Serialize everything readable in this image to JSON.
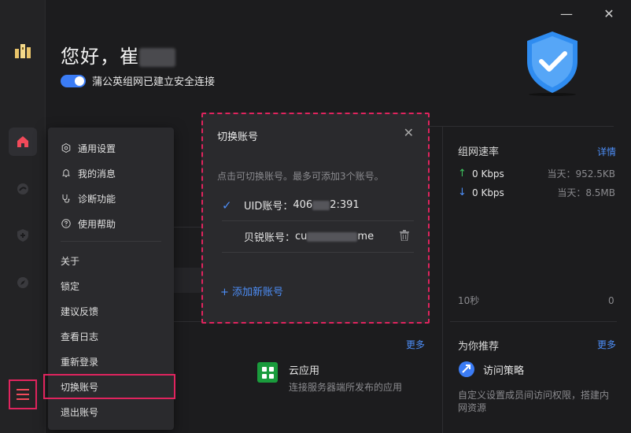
{
  "window": {
    "close_glyph": "✕",
    "minimize_glyph": "—"
  },
  "greeting": {
    "text": "您好，崔"
  },
  "status": {
    "text": "蒲公英组网已建立安全连接",
    "connected": true
  },
  "rail": {
    "items": [
      {
        "name": "home-icon",
        "active": true
      },
      {
        "name": "network-icon",
        "active": false
      },
      {
        "name": "shield-plus-icon",
        "active": false
      },
      {
        "name": "compass-icon",
        "active": false
      }
    ]
  },
  "menu": {
    "group1": [
      {
        "icon": "settings-icon",
        "label": "通用设置"
      },
      {
        "icon": "bell-icon",
        "label": "我的消息"
      },
      {
        "icon": "stethoscope-icon",
        "label": "诊断功能"
      },
      {
        "icon": "help-icon",
        "label": "使用帮助"
      }
    ],
    "group2": [
      {
        "label": "关于"
      },
      {
        "label": "锁定"
      },
      {
        "label": "建议反馈"
      },
      {
        "label": "查看日志"
      },
      {
        "label": "重新登录"
      },
      {
        "label": "切换账号",
        "highlighted": true
      },
      {
        "label": "退出账号"
      }
    ]
  },
  "dialog": {
    "title": "切换账号",
    "hint": "点击可切换账号。最多可添加3个账号。",
    "accounts": [
      {
        "label": "UID账号：",
        "value_prefix": "406",
        "value_suffix": "2:391",
        "selected": true
      },
      {
        "label": "贝锐账号：",
        "value_prefix": "cu",
        "value_suffix": "me",
        "selected": false
      }
    ],
    "add_label": "+ 添加新账号"
  },
  "speed": {
    "title": "组网速率",
    "detail_link": "详情",
    "up": {
      "value": "0 Kbps",
      "today": "当天：952.5KB"
    },
    "down": {
      "value": "0 Kbps",
      "today": "当天：8.5MB"
    },
    "x_label": "10秒",
    "y_label": "0"
  },
  "apps": {
    "more_link": "更多",
    "cloud_app": {
      "title": "云应用",
      "desc": "连接服务器端所发布的应用"
    }
  },
  "recommend": {
    "title": "为你推荐",
    "more_link": "更多",
    "item_title": "访问策略",
    "item_desc": "自定义设置成员间访问权限，搭建内网资源"
  },
  "colors": {
    "accent": "#3b7cf5",
    "highlight": "#e0245e",
    "shield": "#2f8cf0"
  }
}
